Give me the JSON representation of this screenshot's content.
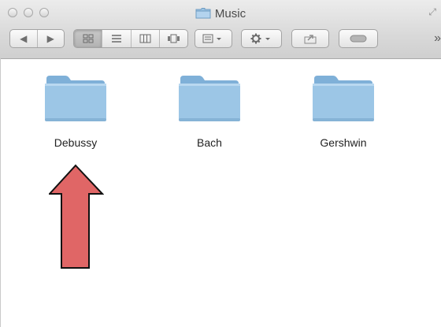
{
  "window": {
    "title": "Music",
    "overflow_label": "»"
  },
  "toolbar": {
    "nav": [
      "◀",
      "▶"
    ],
    "views": [
      "icon",
      "list",
      "column",
      "coverflow"
    ],
    "active_view": "icon"
  },
  "items": [
    {
      "label": "Debussy",
      "icon": "folder-icon"
    },
    {
      "label": "Bach",
      "icon": "folder-icon"
    },
    {
      "label": "Gershwin",
      "icon": "folder-icon"
    }
  ],
  "colors": {
    "folder": "#8fbbdd",
    "arrow": "#e06666"
  }
}
